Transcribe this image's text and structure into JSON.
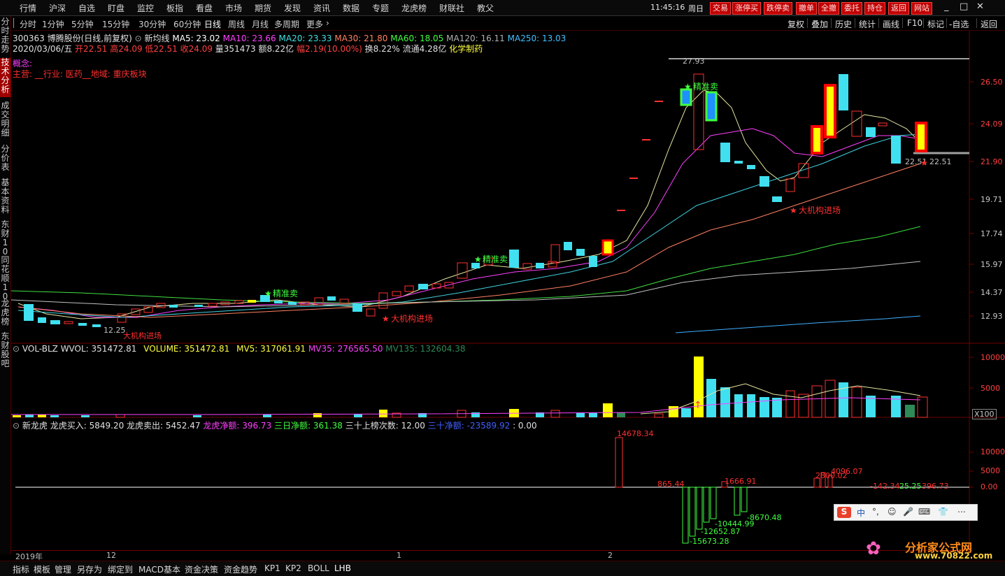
{
  "menu": [
    "行情",
    "沪深",
    "自选",
    "盯盘",
    "监控",
    "板指",
    "看盘",
    "市场",
    "期货",
    "发现",
    "资讯",
    "数据",
    "专题",
    "龙虎榜",
    "财联社",
    "教父"
  ],
  "clock": "11:45:16",
  "weekday": "周日",
  "red_buttons": [
    "交易",
    "涨停买",
    "跌停卖",
    "撤单",
    "全撤",
    "委托",
    "持仓",
    "返回",
    "网站"
  ],
  "window_controls": [
    "_",
    "□",
    "✕"
  ],
  "timeframes": [
    "分时",
    "1分钟",
    "5分钟",
    "15分钟",
    "30分钟",
    "60分钟",
    "日线",
    "周线",
    "月线",
    "多周期",
    "更多"
  ],
  "active_timeframe": "日线",
  "right_tools": [
    "复权",
    "叠加",
    "历史",
    "统计",
    "画线",
    "F10",
    "标记",
    "-自选",
    "返回"
  ],
  "left_tabs": [
    "分时走势",
    "技术分析",
    "成交明细",
    "分价表",
    "基本资料",
    "东财10",
    "同花顺10",
    "龙虎榜",
    "东财股吧"
  ],
  "active_left_tab": "技术分析",
  "stock_line": {
    "code_name": "300363 博腾股份(日线,前复权)",
    "indicator": "新均线",
    "ma5": "MA5: 23.02",
    "ma10": "MA10: 23.66",
    "ma20": "MA20: 23.33",
    "ma30": "MA30: 21.80",
    "ma60": "MA60: 18.05",
    "ma120": "MA120: 16.11",
    "ma250": "MA250: 13.03"
  },
  "quote_line": {
    "date": "2020/03/06/五",
    "open": "开22.51",
    "high": "高24.09",
    "low": "低22.51",
    "close": "收24.09",
    "volume": "量351473",
    "amount": "额8.22亿",
    "change": "幅2.19(10.00%)",
    "turnover": "换8.22%",
    "float": "流通4.28亿",
    "sector": "化学制药"
  },
  "concept_line": "概念:",
  "business_line": "主营: __行业: 医药__地域: 重庆板块",
  "price_axis": [
    "26.50",
    "24.09",
    "21.90",
    "19.71",
    "17.74",
    "15.97",
    "14.37",
    "12.93"
  ],
  "annotations": {
    "high_mark": "27.93",
    "low_mark": "12.25",
    "low_mark_bottom": "大机构进场",
    "sell1": "精准卖",
    "sell2": "精准卖",
    "sell3": "精准卖",
    "buy1": "大机构进场",
    "buy2": "大机构进场",
    "right_label": "22.51 22.51"
  },
  "volume_panel": {
    "title": "VOL-BLZ",
    "wvol": "WVOL: 351472.81",
    "volume": "VOLUME: 351472.81",
    "mv5": "MV5: 317061.91",
    "mv35": "MV35: 276565.50",
    "mv135": "MV135: 132604.38",
    "axis": [
      "10000",
      "5000"
    ],
    "unit": "X100"
  },
  "dragon_panel": {
    "title": "新龙虎",
    "buy": "龙虎买入: 5849.20",
    "sell": "龙虎卖出: 5452.47",
    "net": "龙虎净额: 396.73",
    "net3": "三日净额: 361.38",
    "count": "三十上榜次数: 12.00",
    "net30": "三十净额: -23589.92",
    "extra": ": 0.00",
    "axis": [
      "10000",
      "5000",
      "0.00"
    ],
    "labels": [
      "14678.34",
      "865.44",
      "1666.91",
      "2800.02",
      "4096.07",
      "-142.34",
      "25.25",
      "396.73",
      "-8670.48",
      "-10444.99",
      "-12652.87",
      "-15673.28"
    ]
  },
  "x_axis": [
    "2019年",
    "12",
    "1",
    "2"
  ],
  "bottom_tabs": [
    "指标",
    "模板",
    "管理",
    "另存为",
    "绑定到",
    "MACD基本",
    "资金决策",
    "资金趋势",
    "KP1",
    "KP2",
    "BOLL",
    "LHB"
  ],
  "active_bottom_tab": "LHB",
  "ime": [
    "中",
    "°,",
    "☺",
    "🎤",
    "⌨",
    "👕",
    "⋯"
  ],
  "watermark_text": "分析家公式网",
  "watermark_url": "www.70822.com"
}
